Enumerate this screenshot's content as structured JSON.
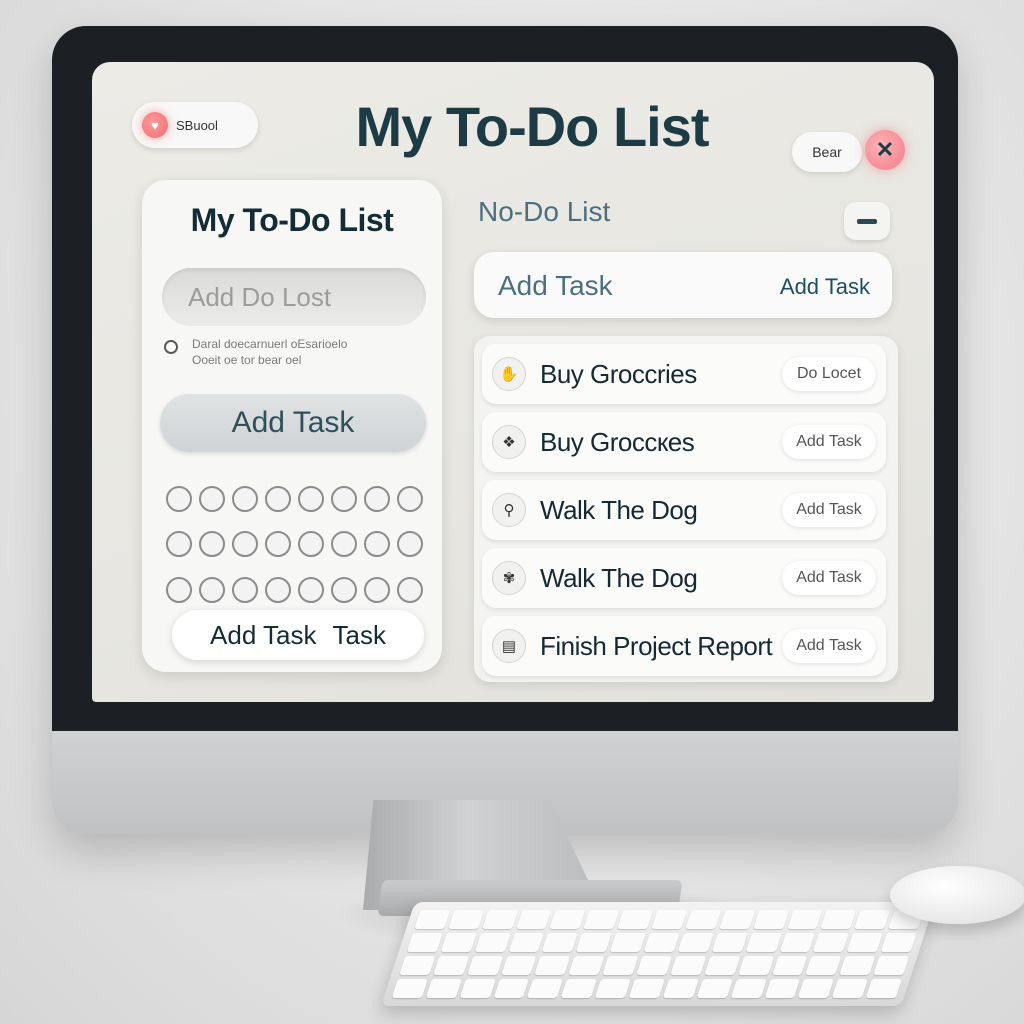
{
  "app": {
    "title": "My To-Do List",
    "top_left_button": "SBuool",
    "top_right_button": "Bear",
    "close_icon": "close-icon",
    "heart_icon": "heart-icon"
  },
  "left_panel": {
    "title": "My To-Do List",
    "input_placeholder": "Add Do Lost",
    "radio_text_line1": "Daral doecarnuerl oEsarioelo",
    "radio_text_line2": "Ooeit oe tor bear oel",
    "add_button": "Add Task",
    "bottom_button_label": "Add Task",
    "bottom_button_label2": "Task",
    "circle_rows": 3,
    "circle_cols": 8
  },
  "right_panel": {
    "title": "No-Do List",
    "add_placeholder": "Add Task",
    "add_action": "Add Task",
    "tasks": [
      {
        "label": "Buy Groccries",
        "button": "Do Locet",
        "icon": "hand-icon"
      },
      {
        "label": "Buy Groccкes",
        "button": "Add Task",
        "icon": "bag-icon"
      },
      {
        "label": "Walk The Dog",
        "button": "Add Task",
        "icon": "pin-icon"
      },
      {
        "label": "Walk The Dog",
        "button": "Add Task",
        "icon": "paw-icon"
      },
      {
        "label": "Finish Project Report",
        "button": "Add Task",
        "icon": "doc-icon"
      }
    ]
  }
}
